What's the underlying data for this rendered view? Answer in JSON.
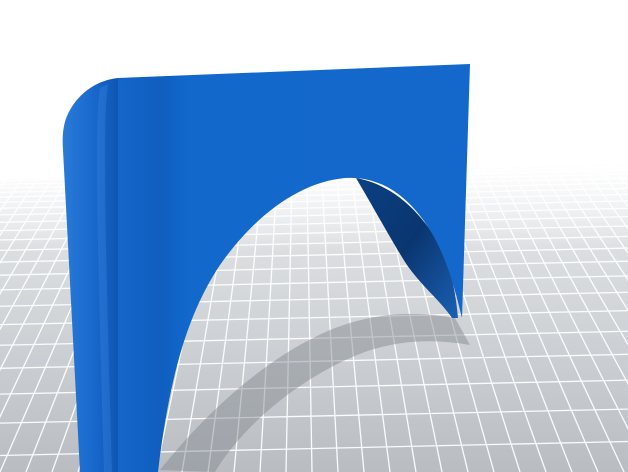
{
  "scene": {
    "kind": "3d-model-render",
    "background_color": "#ffffff",
    "grid_color": "#c4c8cc",
    "grid_line_color": "#ffffff",
    "model_color": "#1464c8",
    "model_shadow_color": "#0b3f86",
    "model_highlight_color": "#3a86e0",
    "shadow_color": "#8f949a"
  }
}
